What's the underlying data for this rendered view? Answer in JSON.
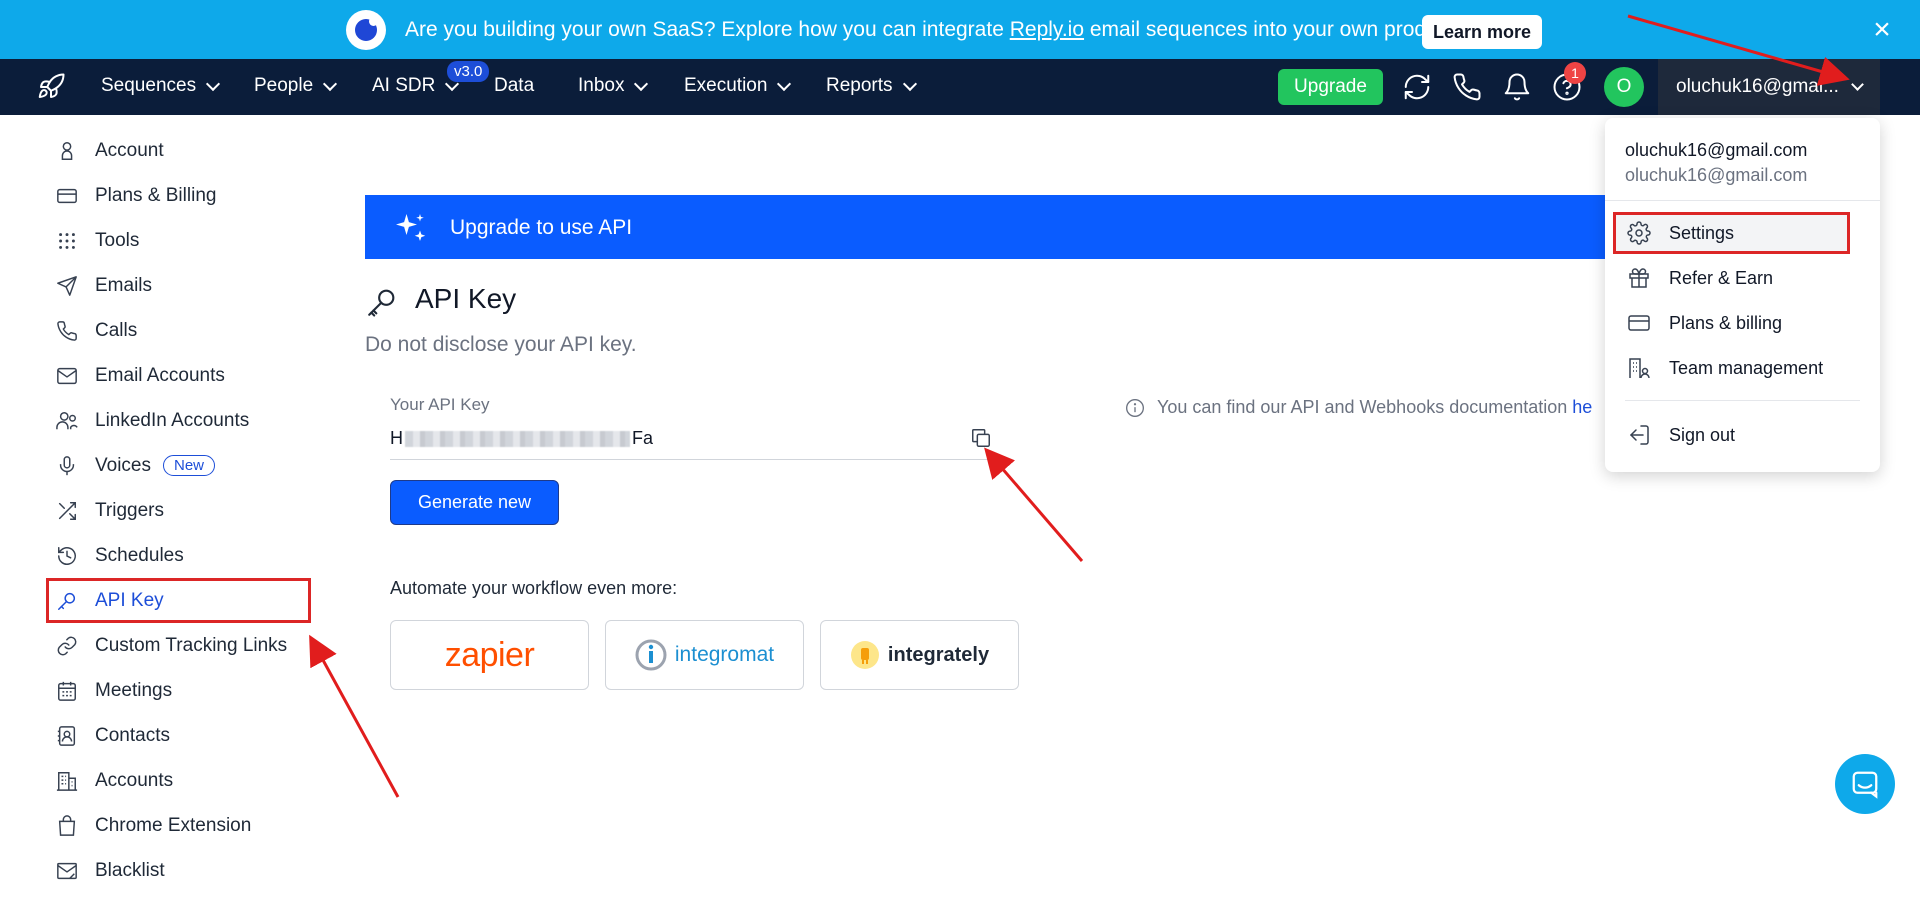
{
  "banner": {
    "text_before": "Are you building your own SaaS? Explore how you can integrate ",
    "link_text": "Reply.io",
    "text_after": " email sequences into your own product.",
    "learn_more": "Learn more",
    "close": "×"
  },
  "nav": {
    "items": [
      "Sequences",
      "People",
      "AI SDR",
      "Data",
      "Inbox",
      "Execution",
      "Reports"
    ],
    "ai_sdr_badge": "v3.0",
    "upgrade": "Upgrade",
    "help_badge": "1",
    "avatar_initial": "O",
    "account_label": "oluchuk16@gmai..."
  },
  "sidebar": {
    "items": [
      {
        "label": "Account",
        "icon": "user-icon"
      },
      {
        "label": "Plans & Billing",
        "icon": "card-icon"
      },
      {
        "label": "Tools",
        "icon": "grid-icon"
      },
      {
        "label": "Emails",
        "icon": "send-icon"
      },
      {
        "label": "Calls",
        "icon": "phone-icon"
      },
      {
        "label": "Email Accounts",
        "icon": "mail-icon"
      },
      {
        "label": "LinkedIn Accounts",
        "icon": "users-icon"
      },
      {
        "label": "Voices",
        "icon": "mic-icon",
        "badge": "New"
      },
      {
        "label": "Triggers",
        "icon": "shuffle-icon"
      },
      {
        "label": "Schedules",
        "icon": "history-icon"
      },
      {
        "label": "API Key",
        "icon": "key-icon",
        "active": true
      },
      {
        "label": "Custom Tracking Links",
        "icon": "link-icon"
      },
      {
        "label": "Meetings",
        "icon": "calendar-icon"
      },
      {
        "label": "Contacts",
        "icon": "contacts-icon"
      },
      {
        "label": "Accounts",
        "icon": "building-icon"
      },
      {
        "label": "Chrome Extension",
        "icon": "bag-icon"
      },
      {
        "label": "Blacklist",
        "icon": "blocked-mail-icon"
      }
    ]
  },
  "main": {
    "upgrade_bar": "Upgrade to use API",
    "title": "API Key",
    "subtitle": "Do not disclose your API key.",
    "field_label": "Your API Key",
    "key_prefix": "H",
    "key_suffix": "Fa",
    "generate": "Generate new",
    "info_text": "You can find our API and Webhooks documentation ",
    "info_link": "he",
    "automate": "Automate your workflow even more:",
    "integrations": [
      "zapier",
      "integromat",
      "integrately"
    ]
  },
  "dropdown": {
    "name": "oluchuk16@gmail.com",
    "email": "oluchuk16@gmail.com",
    "items": [
      "Settings",
      "Refer & Earn",
      "Plans & billing",
      "Team management"
    ],
    "sign_out": "Sign out"
  },
  "colors": {
    "banner": "#0ea9ea",
    "nav": "#0b1d3a",
    "primary": "#0a5cff",
    "upgrade_green": "#22c55e",
    "annotation_red": "#dc2626"
  }
}
